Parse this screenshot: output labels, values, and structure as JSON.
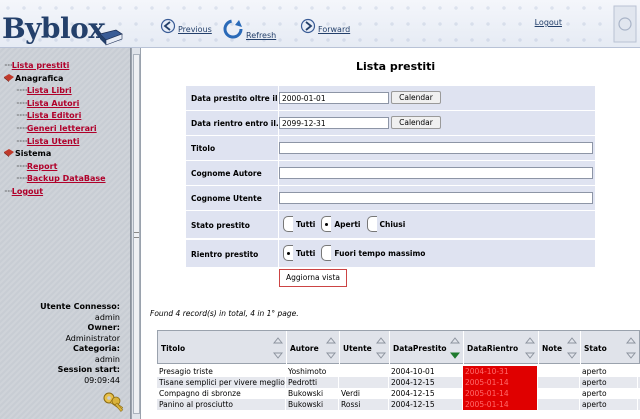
{
  "header": {
    "app_name": "Byblox",
    "nav": [
      {
        "label": "Previous",
        "icon": "back-arrow-icon"
      },
      {
        "label": "Refresh",
        "icon": "refresh-icon"
      },
      {
        "label": "Forward",
        "icon": "forward-arrow-icon"
      }
    ],
    "logout": "Logout"
  },
  "sidebar": {
    "items": [
      {
        "label": "Lista prestiti",
        "kind": "link"
      },
      {
        "label": "Anagrafica",
        "kind": "group"
      },
      {
        "label": "Lista Libri",
        "kind": "link"
      },
      {
        "label": "Lista Autori",
        "kind": "link"
      },
      {
        "label": "Lista Editori",
        "kind": "link"
      },
      {
        "label": "Generi letterari",
        "kind": "link"
      },
      {
        "label": "Lista Utenti",
        "kind": "link"
      },
      {
        "label": "Sistema",
        "kind": "group"
      },
      {
        "label": "Report",
        "kind": "link"
      },
      {
        "label": "Backup DataBase",
        "kind": "link"
      },
      {
        "label": "Logout",
        "kind": "link"
      }
    ],
    "user_info": {
      "connected_label": "Utente Connesso:",
      "connected_value": "admin",
      "owner_label": "Owner:",
      "owner_value": "Administrator",
      "category_label": "Categoria:",
      "category_value": "admin",
      "session_label": "Session start:",
      "session_value": "09:09:44"
    }
  },
  "main": {
    "title": "Lista prestiti",
    "filters": {
      "data_prestito_label": "Data prestito oltre il...",
      "data_prestito_value": "2000-01-01",
      "data_rientro_label": "Data rientro entro il...",
      "data_rientro_value": "2099-12-31",
      "calendar_label": "Calendar",
      "titolo_label": "Titolo",
      "titolo_value": "",
      "cognome_autore_label": "Cognome Autore",
      "cognome_autore_value": "",
      "cognome_utente_label": "Cognome Utente",
      "cognome_utente_value": "",
      "stato_label": "Stato prestito",
      "stato_options": [
        "Tutti",
        "Aperti",
        "Chiusi"
      ],
      "stato_selected": "Aperti",
      "rientro_label": "Rientro prestito",
      "rientro_options": [
        "Tutti",
        "Fuori tempo massimo"
      ],
      "rientro_selected": "Tutti",
      "update_button": "Aggiorna vista"
    },
    "found_text": "Found 4 record(s) in total, 4 in 1° page.",
    "table": {
      "columns": [
        "Titolo",
        "Autore",
        "Utente",
        "DataPrestito",
        "DataRientro",
        "Note",
        "Stato"
      ],
      "rows": [
        [
          "Presagio triste",
          "Yoshimoto",
          "",
          "2004-10-01",
          "2004-10-31",
          "",
          "aperto"
        ],
        [
          "Tisane semplici per vivere meglio",
          "Pedrotti",
          "",
          "2004-12-15",
          "2005-01-14",
          "",
          "aperto"
        ],
        [
          "Compagno di sbronze",
          "Bukowski",
          "Verdi",
          "2004-12-15",
          "2005-01-14",
          "",
          "aperto"
        ],
        [
          "Panino al prosciutto",
          "Bukowski",
          "Rossi",
          "2004-12-15",
          "2005-01-14",
          "",
          "aperto"
        ]
      ]
    }
  },
  "colors": {
    "brand": "#24406b",
    "link": "#b0002a",
    "overdue": "#e00000"
  }
}
